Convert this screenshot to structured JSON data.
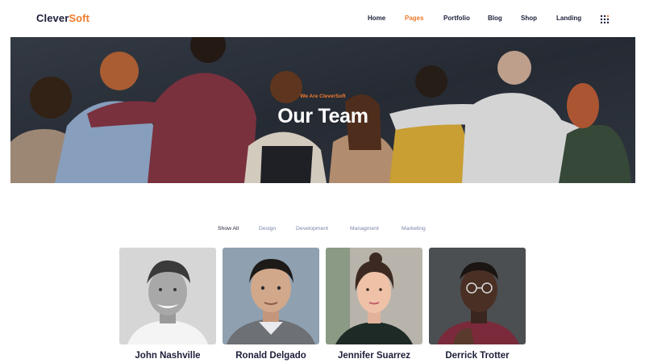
{
  "brand": {
    "part1": "Clever",
    "part2": "Soft"
  },
  "nav": {
    "items": [
      {
        "label": "Home",
        "active": false
      },
      {
        "label": "Pages",
        "active": true
      },
      {
        "label": "Portfolio",
        "active": false
      },
      {
        "label": "Blog",
        "active": false
      },
      {
        "label": "Shop",
        "active": false
      },
      {
        "label": "Landing",
        "active": false
      }
    ],
    "menu_icon": "dots-grid-icon"
  },
  "hero": {
    "subtitle": "We Are CleverSoft",
    "title": "Our Team"
  },
  "filters": [
    {
      "label": "Show All",
      "active": true
    },
    {
      "label": "Design",
      "active": false
    },
    {
      "label": "Development",
      "active": false
    },
    {
      "label": "Managment",
      "active": false
    },
    {
      "label": "Marketing",
      "active": false
    }
  ],
  "team": [
    {
      "name": "John Nashville"
    },
    {
      "name": "Ronald Delgado"
    },
    {
      "name": "Jennifer Suarrez"
    },
    {
      "name": "Derrick Trotter"
    }
  ],
  "colors": {
    "accent": "#f07a2b",
    "text_dark": "#1c1f3a",
    "filter_muted": "#7b86a8"
  }
}
